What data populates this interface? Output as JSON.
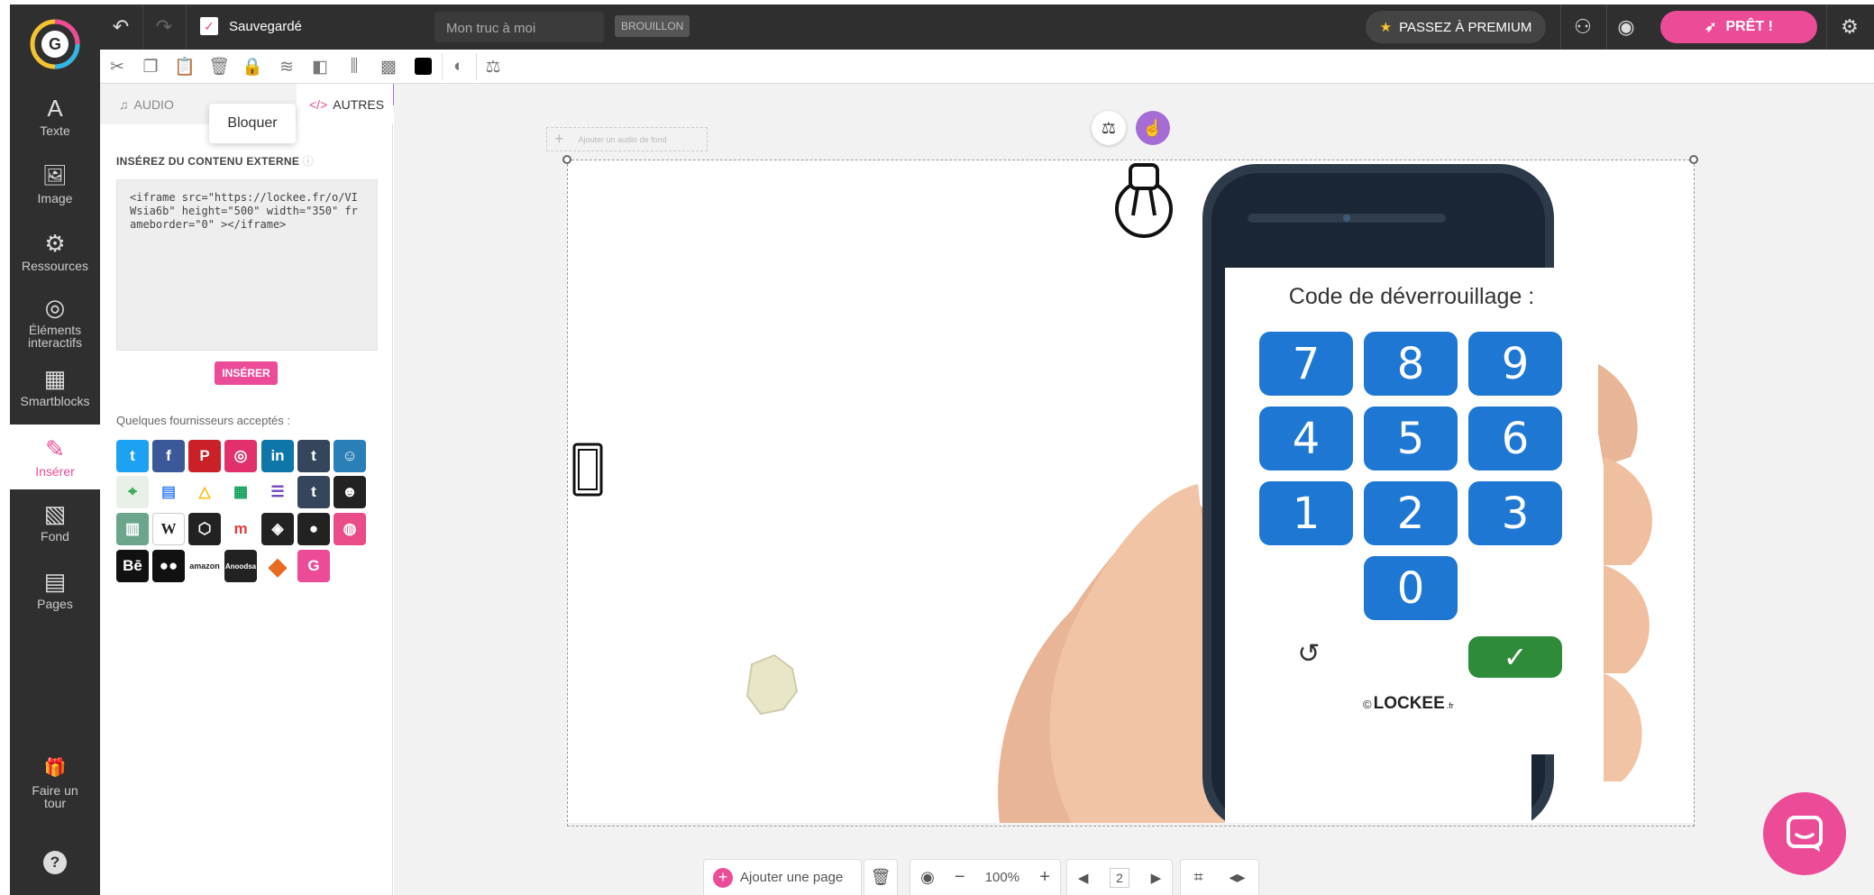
{
  "app": {
    "status": "Sauvegardé",
    "doc_title": "Mon truc à moi",
    "badge": "BROUILLON",
    "premium": "PASSEZ À PREMIUM",
    "ready": "PRÊT !"
  },
  "sidebar": {
    "items": [
      {
        "label": "Texte",
        "icon": "A"
      },
      {
        "label": "Image",
        "icon": "🖼"
      },
      {
        "label": "Ressources",
        "icon": "⚙"
      },
      {
        "label": "Éléments interactifs",
        "icon": "◎"
      },
      {
        "label": "Smartblocks",
        "icon": "▦"
      },
      {
        "label": "Insérer",
        "icon": "✎"
      },
      {
        "label": "Fond",
        "icon": "▧"
      },
      {
        "label": "Pages",
        "icon": "▤"
      }
    ],
    "tour": "Faire un tour",
    "help": "?"
  },
  "panel": {
    "tab_audio": "AUDIO",
    "tab_autres": "AUTRES",
    "tooltip": "Bloquer",
    "section_title": "INSÉREZ DU CONTENU EXTERNE",
    "code": "<iframe src=\"https://lockee.fr/o/VIWsia6b\" height=\"500\" width=\"350\" frameborder=\"0\" ></iframe>",
    "insert_button": "INSÉRER",
    "providers_label": "Quelques fournisseurs acceptés :",
    "providers": [
      [
        "twitter",
        "facebook",
        "pinterest",
        "instagram",
        "linkedin",
        "tumblr",
        "slideshare"
      ],
      [
        "google-maps",
        "google-docs",
        "google-drive",
        "google-sheets",
        "google-forms",
        "tumblr-t",
        "mailchimp"
      ],
      [
        "analytics",
        "wikipedia",
        "codepen-cube",
        "meetup",
        "codepen",
        "github",
        "dribbble"
      ],
      [
        "behance",
        "flickr",
        "amazon",
        "anoodsa",
        "sketchfab",
        "genially"
      ]
    ]
  },
  "canvas": {
    "audio_placeholder": "Ajouter un audio de fond",
    "phone_title": "Code de déverrouillage :",
    "keys": [
      "7",
      "8",
      "9",
      "4",
      "5",
      "6",
      "1",
      "2",
      "3",
      "0"
    ],
    "check": "✓",
    "reset": "↺",
    "brand_prefix": "©",
    "brand": "LOCKEE",
    "brand_suffix": ".fr"
  },
  "bottom": {
    "add_page": "Ajouter une page",
    "zoom": "100%",
    "page": "2"
  },
  "colors": {
    "accent": "#ec4b98",
    "keypad": "#1e78d3",
    "ok": "#2e8b3a",
    "dark": "#2f2f2f"
  }
}
